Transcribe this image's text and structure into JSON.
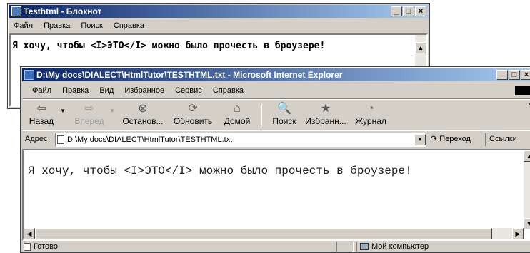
{
  "notepad": {
    "title": "Testhtml - Блокнот",
    "menu": [
      "Файл",
      "Правка",
      "Поиск",
      "Справка"
    ],
    "menu_underline": [
      "Ф",
      "П",
      "и",
      "С"
    ],
    "content": "Я хочу, чтобы <I>ЭТО</I> можно было прочесть в броузере!"
  },
  "ie": {
    "title": "D:\\My docs\\DIALECT\\HtmlTutor\\TESTHTML.txt - Microsoft Internet Explorer",
    "menu": [
      "Файл",
      "Правка",
      "Вид",
      "Избранное",
      "Сервис",
      "Справка"
    ],
    "toolbar": {
      "back": "Назад",
      "forward": "Вперед",
      "stop": "Останов...",
      "refresh": "Обновить",
      "home": "Домой",
      "search": "Поиск",
      "favorites": "Избранн...",
      "history": "Журнал"
    },
    "address": {
      "label": "Адрес",
      "value": "D:\\My docs\\DIALECT\\HtmlTutor\\TESTHTML.txt",
      "go": "Переход",
      "links": "Ссылки"
    },
    "content": "Я хочу, чтобы <I>ЭТО</I> можно было прочесть в броузере!",
    "status": {
      "left": "Готово",
      "zone": "Мой компьютер"
    }
  },
  "colors": {
    "titlebar_start": "#0a246a",
    "titlebar_end": "#a6caf0",
    "face": "#d4d0c8"
  },
  "icons": {
    "back": "arrow-left-icon",
    "forward": "arrow-right-icon",
    "stop": "stop-icon",
    "refresh": "refresh-icon",
    "home": "home-icon",
    "search": "search-icon",
    "favorites": "favorites-icon",
    "history": "history-icon"
  }
}
